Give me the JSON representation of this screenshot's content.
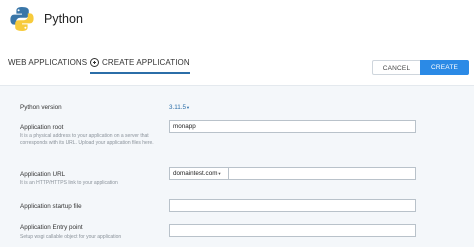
{
  "header": {
    "title": "Python",
    "logo": "python-logo-icon"
  },
  "tabs": [
    {
      "label": "WEB APPLICATIONS"
    },
    {
      "label": "CREATE APPLICATION",
      "icon": "plus-circle-icon"
    }
  ],
  "actions": {
    "cancel": "CANCEL",
    "create": "CREATE"
  },
  "form": {
    "python_version": {
      "label": "Python version",
      "value": "3.11.5"
    },
    "app_root": {
      "label": "Application root",
      "help": "It is a physical address to your application on a server that corresponds with its URL. Upload your application files here.",
      "value": "monapp"
    },
    "app_url": {
      "label": "Application URL",
      "help": "It is an HTTP/HTTPS link to your application",
      "domain": "domaintest.com",
      "path": ""
    },
    "startup_file": {
      "label": "Application startup file",
      "value": ""
    },
    "entry_point": {
      "label": "Application Entry point",
      "help": "Setup wsgi callable object for your application",
      "value": ""
    }
  },
  "colors": {
    "accent": "#2b8ae6",
    "link": "#2b6ea8",
    "panel": "#f4f7fa"
  }
}
